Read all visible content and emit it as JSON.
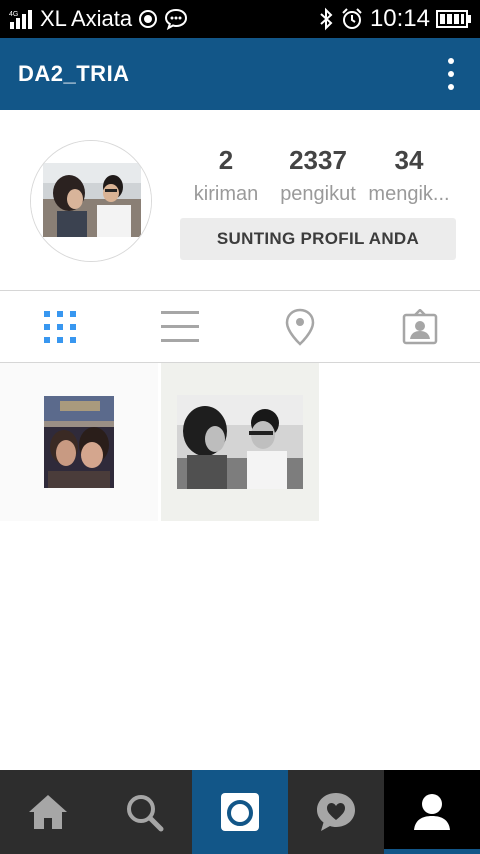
{
  "status_bar": {
    "carrier": "XL Axiata",
    "time": "10:14",
    "icons": [
      "signal-icon",
      "location-icon",
      "chat-icon",
      "bluetooth-icon",
      "alarm-icon",
      "battery-icon"
    ]
  },
  "app_bar": {
    "title": "DA2_TRIA",
    "menu_icon": "overflow-menu-icon",
    "background_color": "#125688"
  },
  "profile": {
    "stats": [
      {
        "value": "2",
        "label": "kiriman"
      },
      {
        "value": "2337",
        "label": "pengikut"
      },
      {
        "value": "34",
        "label": "mengik..."
      }
    ],
    "edit_button_label": "SUNTING PROFIL ANDA"
  },
  "view_tabs": [
    {
      "name": "grid-view",
      "icon": "grid-icon",
      "active": true
    },
    {
      "name": "list-view",
      "icon": "list-icon",
      "active": false
    },
    {
      "name": "location-view",
      "icon": "location-pin-icon",
      "active": false
    },
    {
      "name": "tagged-view",
      "icon": "tagged-photo-icon",
      "active": false
    }
  ],
  "posts": [
    {
      "description": "couple selfie at night"
    },
    {
      "description": "black and white couple photo"
    }
  ],
  "bottom_nav": [
    {
      "name": "home",
      "icon": "home-icon",
      "active": false
    },
    {
      "name": "search",
      "icon": "search-icon",
      "active": false
    },
    {
      "name": "camera",
      "icon": "camera-icon",
      "active": false
    },
    {
      "name": "activity",
      "icon": "heart-bubble-icon",
      "active": false
    },
    {
      "name": "profile",
      "icon": "profile-icon",
      "active": true
    }
  ],
  "colors": {
    "accent": "#125688",
    "active_tab": "#3897f0",
    "nav_bg": "#2d2d2d"
  }
}
